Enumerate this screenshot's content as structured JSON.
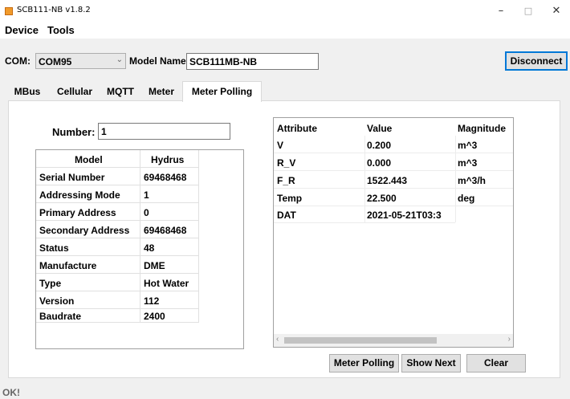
{
  "window": {
    "title": "SCB111-NB v1.8.2",
    "minimize": "–",
    "maximize": "□",
    "close": "✕"
  },
  "menu": [
    "Device",
    "Tools"
  ],
  "connection": {
    "com_label": "COM:",
    "com_value": "COM95",
    "model_name_label": "Model Name:",
    "model_name_value": "SCB111MB-NB",
    "disconnect_label": "Disconnect"
  },
  "tabs": [
    "MBus",
    "Cellular",
    "MQTT",
    "Meter",
    "Meter Polling"
  ],
  "active_tab": "Meter Polling",
  "meter_polling": {
    "number_label": "Number:",
    "number_value": "1",
    "info_header": [
      "Model",
      "Hydrus"
    ],
    "info_rows": [
      [
        "Serial Number",
        "69468468"
      ],
      [
        "Addressing Mode",
        "1"
      ],
      [
        "Primary Address",
        "0"
      ],
      [
        "Secondary Address",
        "69468468"
      ],
      [
        "Status",
        "48"
      ],
      [
        "Manufacture",
        "DME"
      ],
      [
        "Type",
        "Hot Water"
      ],
      [
        "Version",
        "112"
      ],
      [
        "Baudrate",
        "2400"
      ]
    ],
    "records_header": [
      "Attribute",
      "Value",
      "Magnitude"
    ],
    "records": [
      [
        "V",
        "0.200",
        "m^3"
      ],
      [
        "R_V",
        "0.000",
        "m^3"
      ],
      [
        "F_R",
        "1522.443",
        "m^3/h"
      ],
      [
        "Temp",
        "22.500",
        "deg"
      ],
      [
        "DAT",
        "2021-05-21T03:3",
        ""
      ]
    ],
    "buttons": {
      "meter_polling": "Meter Polling",
      "show_next": "Show Next",
      "clear": "Clear"
    }
  },
  "status_text": "OK!",
  "colors": {
    "accent": "#0078d7",
    "app_icon": "#f19a2a"
  },
  "icons": {
    "app": "app-icon",
    "dropdown": "chevron-down-icon"
  }
}
